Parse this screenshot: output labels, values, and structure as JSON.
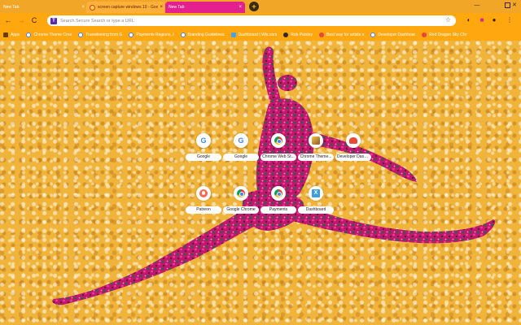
{
  "tabs": [
    {
      "title": "New Tab",
      "close": "×"
    },
    {
      "title": "screen capture windows 10 - Goo",
      "close": "×"
    },
    {
      "title": "New Tab",
      "close": "×"
    }
  ],
  "new_tab_button": "+",
  "window_controls": {
    "minimize": "—",
    "close": "✕"
  },
  "toolbar": {
    "back": "←",
    "forward": "→",
    "reload": "C",
    "home": "⌂",
    "omnibox_badge": "T",
    "omnibox_placeholder": "Search Secure Search or type a URL",
    "star": "☆",
    "menu": "⋮"
  },
  "bookmarks": [
    {
      "label": "Apps"
    },
    {
      "label": "Chrome Theme Crea"
    },
    {
      "label": "Transitioning from G"
    },
    {
      "label": "Payments Regions, I"
    },
    {
      "label": "Branding Guidelines"
    },
    {
      "label": "Dashboard | Wix.com"
    },
    {
      "label": "Rob Paisley"
    },
    {
      "label": "Best way for artists o"
    },
    {
      "label": "Developer Dashboar"
    },
    {
      "label": "Red Dragon Sky Chr"
    }
  ],
  "shortcuts": [
    {
      "label": "Google",
      "icon": "G"
    },
    {
      "label": "Google",
      "icon": "G"
    },
    {
      "label": "Chrome Web St...",
      "icon": "chrome-web-store-icon"
    },
    {
      "label": "Chrome Theme...",
      "icon": "theme-icon"
    },
    {
      "label": "Developer Dash...",
      "icon": "developer-icon"
    },
    {
      "label": "Patreon",
      "icon": "patreon-icon"
    },
    {
      "label": "Google Chrome",
      "icon": "chrome-icon"
    },
    {
      "label": "Payments",
      "icon": "chrome-icon"
    },
    {
      "label": "Dashboard",
      "icon": "X"
    }
  ],
  "colors": {
    "tabstrip": "#f2a627",
    "toolbar": "#ffa70f",
    "active_tab": "#e3208d",
    "background": "#f0b43a",
    "dancer_pink": "#d81b7a",
    "dancer_green": "#2f5e4a"
  }
}
